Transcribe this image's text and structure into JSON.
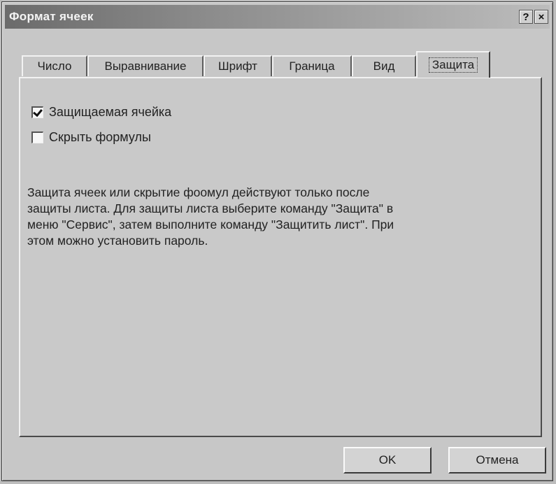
{
  "window": {
    "title": "Формат ячеек",
    "help_label": "?",
    "close_label": "×"
  },
  "tabs": [
    {
      "label": "Число"
    },
    {
      "label": "Выравнивание"
    },
    {
      "label": "Шрифт"
    },
    {
      "label": "Граница"
    },
    {
      "label": "Вид"
    },
    {
      "label": "Защита",
      "active": true
    }
  ],
  "protection": {
    "locked_label": "Защищаемая ячейка",
    "locked_checked": true,
    "hidden_label": "Скрыть формулы",
    "hidden_checked": false,
    "note": "Защита ячеек или скрытие фоомул действуют только после\nзащиты листа. Для защиты листа выберите команду \"Защита\" в\nменю \"Сервис\", затем выполните команду \"Защитить лист\". При\nэтом можно установить пароль."
  },
  "buttons": {
    "ok_label": "OK",
    "cancel_label": "Отмена"
  }
}
